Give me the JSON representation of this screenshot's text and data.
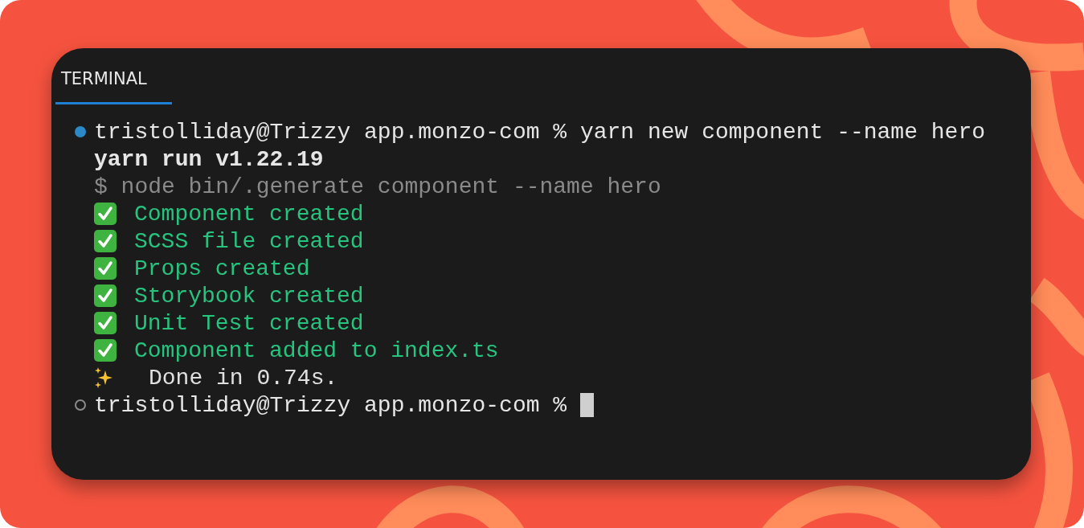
{
  "panel": {
    "tabs": [
      {
        "label": "TERMINAL",
        "selected": true
      }
    ]
  },
  "terminal": {
    "lines": [
      {
        "kind": "prompt",
        "active": true,
        "prompt": "tristolliday@Trizzy app.monzo-com %",
        "command": "yarn new component --name hero",
        "cursor": false
      },
      {
        "kind": "bold",
        "text": "yarn run v1.22.19"
      },
      {
        "kind": "dim",
        "text": "$ node bin/.generate component --name hero"
      },
      {
        "kind": "success",
        "text": "Component created"
      },
      {
        "kind": "success",
        "text": "SCSS file created"
      },
      {
        "kind": "success",
        "text": "Props created"
      },
      {
        "kind": "success",
        "text": "Storybook created"
      },
      {
        "kind": "success",
        "text": "Unit Test created"
      },
      {
        "kind": "success",
        "text": "Component added to index.ts"
      },
      {
        "kind": "done",
        "text": "Done in 0.74s."
      },
      {
        "kind": "prompt",
        "active": false,
        "prompt": "tristolliday@Trizzy app.monzo-com %",
        "cursor": true
      }
    ]
  }
}
